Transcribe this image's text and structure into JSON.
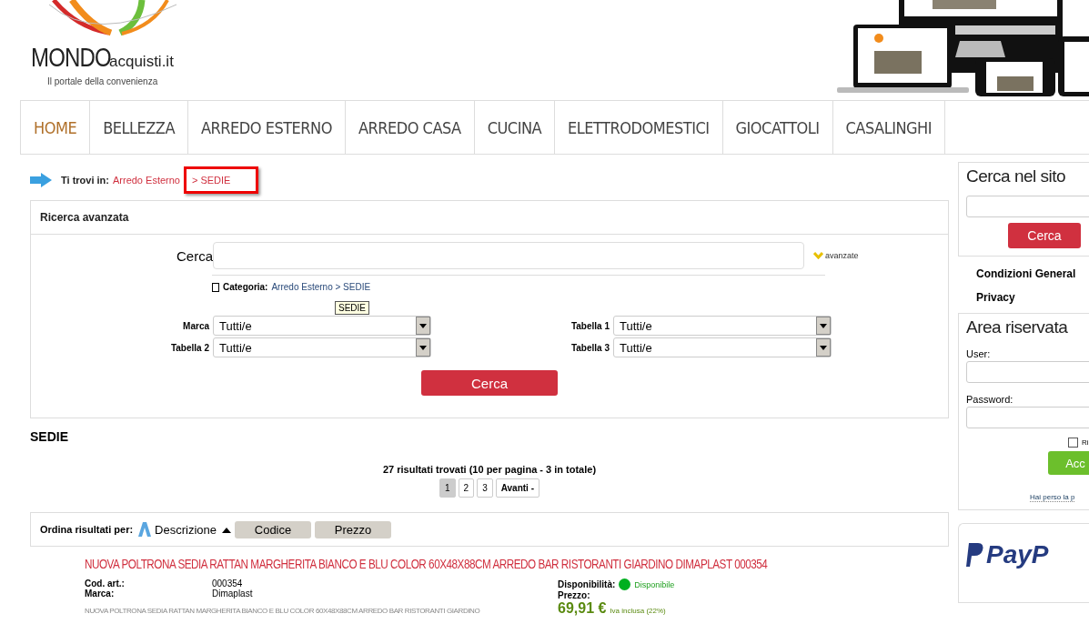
{
  "logo": {
    "brand_main": "MONDO",
    "brand_sub": "acquisti.it",
    "tagline": "Il portale della convenienza"
  },
  "nav": [
    {
      "label": "HOME",
      "selected": true
    },
    {
      "label": "BELLEZZA",
      "selected": false
    },
    {
      "label": "ARREDO ESTERNO",
      "selected": false
    },
    {
      "label": "ARREDO CASA",
      "selected": false
    },
    {
      "label": "CUCINA",
      "selected": false
    },
    {
      "label": "ELETTRODOMESTICI",
      "selected": false
    },
    {
      "label": "GIOCATTOLI",
      "selected": false
    },
    {
      "label": "CASALINGHI",
      "selected": false
    }
  ],
  "breadcrumb": {
    "prefix": "Ti trovi in:",
    "path": [
      {
        "label": "Arredo Esterno"
      },
      {
        "label": "> SEDIE",
        "highlighted": true
      }
    ]
  },
  "advanced_search": {
    "title": "Ricerca avanzata",
    "search_label": "Cerca",
    "advanced_link": "avanzate",
    "category_label": "Categoria:",
    "category_value": "Arredo Esterno > SEDIE",
    "tooltip": "SEDIE",
    "filters": [
      {
        "label": "Marca",
        "value": "Tutti/e"
      },
      {
        "label": "Tabella 1",
        "value": "Tutti/e"
      },
      {
        "label": "Tabella 2",
        "value": "Tutti/e"
      },
      {
        "label": "Tabella 3",
        "value": "Tutti/e"
      }
    ],
    "button": "Cerca"
  },
  "category_title": "SEDIE",
  "results": {
    "summary": "27 risultati trovati (10 per pagina - 3 in totale)",
    "pages": [
      {
        "label": "1",
        "selected": true
      },
      {
        "label": "2",
        "selected": false
      },
      {
        "label": "3",
        "selected": false
      }
    ],
    "next": "Avanti -"
  },
  "sort": {
    "label": "Ordina risultati per:",
    "options": [
      {
        "label": "Descrizione",
        "selected": true
      },
      {
        "label": "Codice",
        "selected": false
      },
      {
        "label": "Prezzo",
        "selected": false
      }
    ]
  },
  "products": [
    {
      "title": "NUOVA POLTRONA SEDIA RATTAN MARGHERITA BIANCO E BLU COLOR 60X48X88CM ARREDO BAR RISTORANTI GIARDINO DIMAPLAST 000354",
      "code_label": "Cod. art.:",
      "code": "000354",
      "brand_label": "Marca:",
      "brand": "Dimaplast",
      "description": "NUOVA POLTRONA SEDIA RATTAN MARGHERITA BIANCO E BLU COLOR 60X48X88CM ARREDO BAR RISTORANTI GIARDINO",
      "availability_label": "Disponibilità:",
      "availability": "Disponibile",
      "color": "#00b020",
      "price_label": "Prezzo:",
      "price": "69,91 €",
      "vat": "Iva inclusa (22%)"
    }
  ],
  "sidebar": {
    "search_title": "Cerca nel sito",
    "search_button": "Cerca",
    "links": [
      "Condizioni General",
      "Privacy"
    ],
    "login_title": "Area riservata",
    "user_label": "User:",
    "password_label": "Password:",
    "remember": {
      "label": "Ri",
      "checked": false
    },
    "login_button": "Acc",
    "forgot_link": "Hai perso la p",
    "payment_logo": "PayP"
  }
}
